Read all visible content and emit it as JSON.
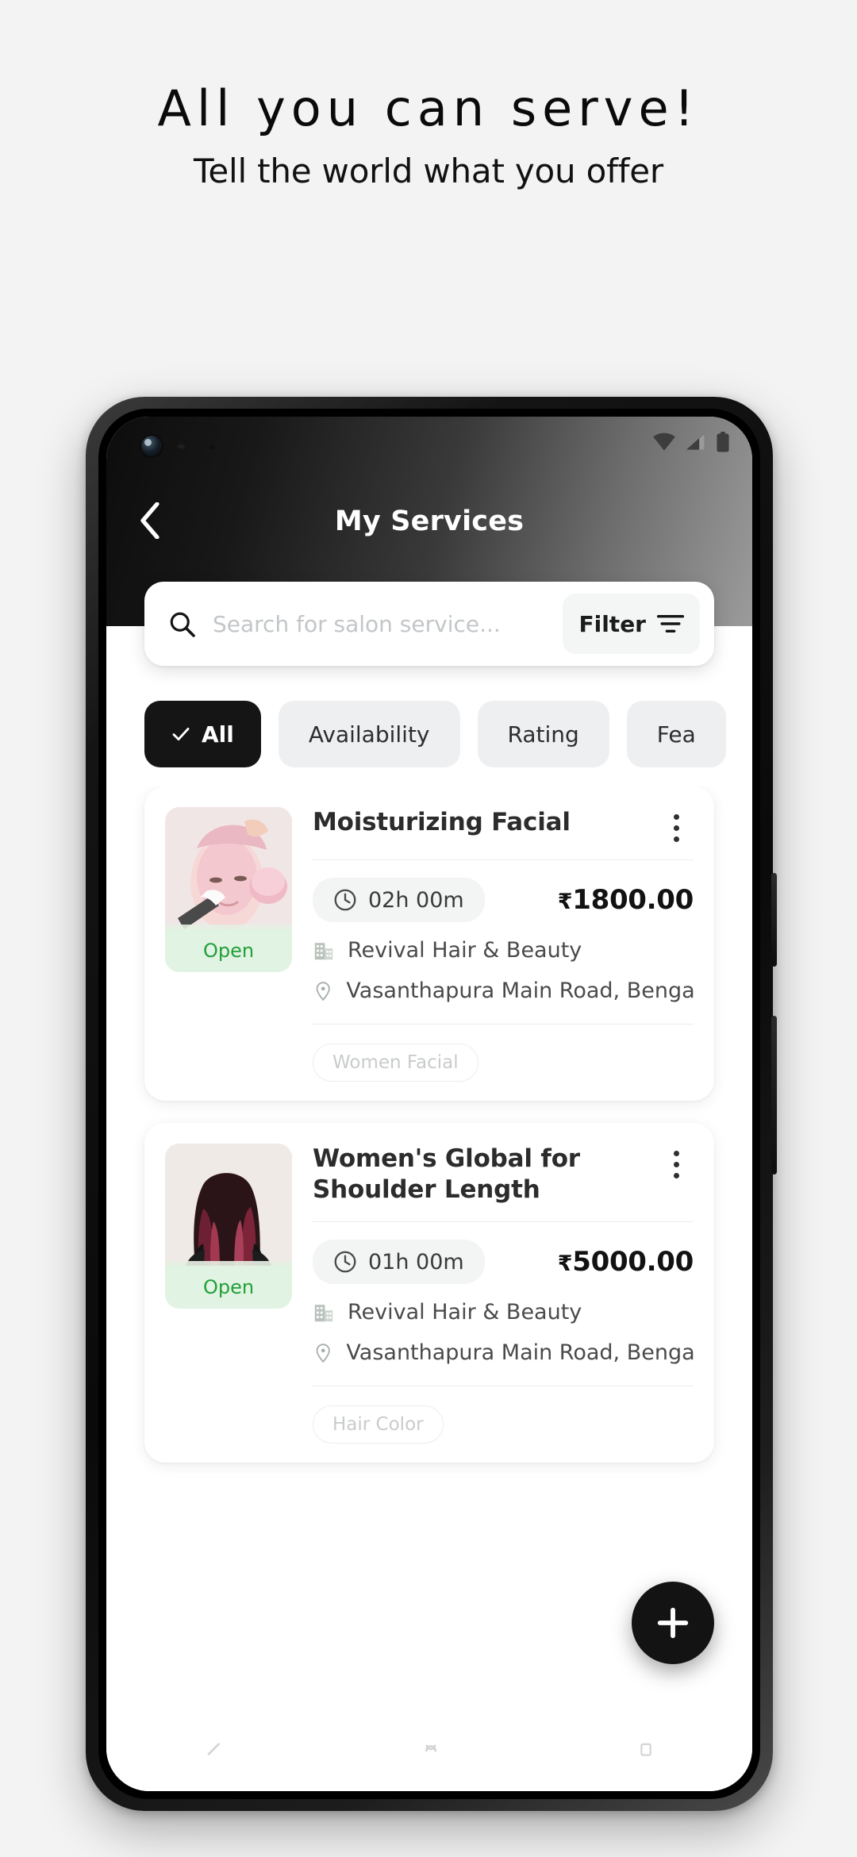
{
  "promo": {
    "title": "All you can serve!",
    "subtitle": "Tell the world what you offer"
  },
  "statusbar": {
    "wifi_icon": "wifi-icon",
    "signal_icon": "cellular-signal-icon",
    "battery_icon": "battery-icon"
  },
  "appbar": {
    "back_icon": "chevron-left-icon",
    "title": "My Services"
  },
  "search": {
    "icon": "search-icon",
    "placeholder": "Search for salon service...",
    "value": "",
    "filter_label": "Filter",
    "filter_icon": "filter-icon"
  },
  "chips": [
    {
      "label": "All",
      "selected": true,
      "icon": "check-icon"
    },
    {
      "label": "Availability",
      "selected": false
    },
    {
      "label": "Rating",
      "selected": false
    },
    {
      "label": "Fea",
      "selected": false
    }
  ],
  "cards": [
    {
      "title": "Moisturizing Facial",
      "status_badge": "Open",
      "duration": "02h 00m",
      "duration_icon": "clock-icon",
      "currency": "₹",
      "price": "1800.00",
      "salon_icon": "building-icon",
      "salon": "Revival Hair & Beauty",
      "location_icon": "map-pin-icon",
      "location": "Vasanthapura Main Road, Bengalu",
      "tags": [
        "Women Facial"
      ],
      "menu_icon": "kebab-menu-icon"
    },
    {
      "title": "Women's Global for Shoulder Length",
      "status_badge": "Open",
      "duration": "01h 00m",
      "duration_icon": "clock-icon",
      "currency": "₹",
      "price": "5000.00",
      "salon_icon": "building-icon",
      "salon": "Revival Hair & Beauty",
      "location_icon": "map-pin-icon",
      "location": "Vasanthapura Main Road, Bengalu",
      "tags": [
        "Hair Color"
      ],
      "menu_icon": "kebab-menu-icon"
    }
  ],
  "fab": {
    "icon": "plus-icon",
    "label": ""
  },
  "navbar": {
    "back_icon": "nav-back-icon",
    "home_icon": "nav-home-icon",
    "recents_icon": "nav-recents-icon"
  },
  "colors": {
    "background": "#f2f3f2",
    "accent_dark": "#131313",
    "open_text": "#22a03a",
    "open_bg": "#e1f3e2",
    "chip_bg": "#eeeff0"
  }
}
